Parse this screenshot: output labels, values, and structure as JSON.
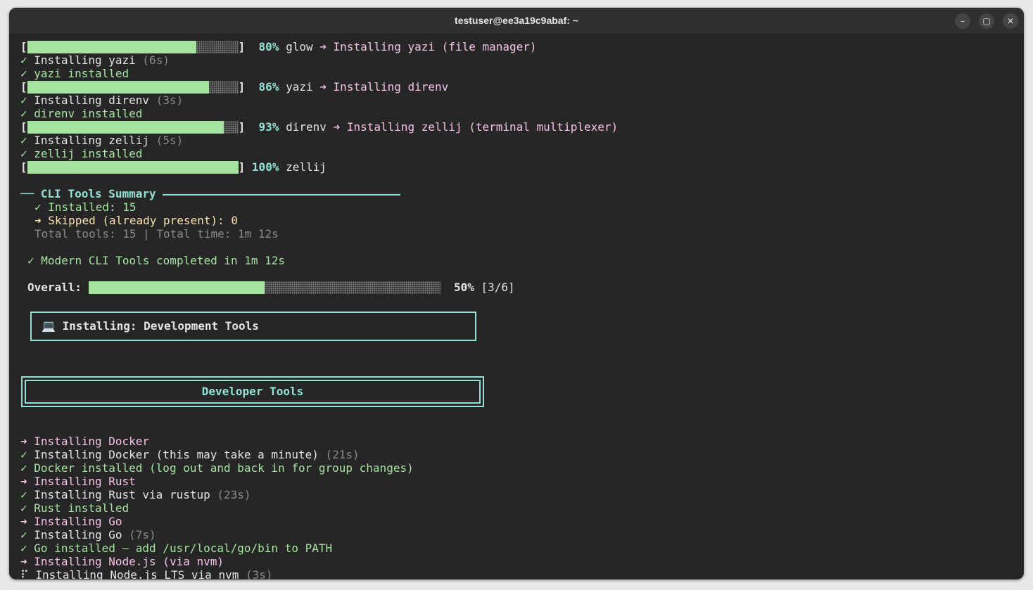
{
  "window": {
    "title": "testuser@ee3a19c9abaf: ~",
    "minimize_icon": "–",
    "maximize_icon": "▢",
    "close_icon": "✕"
  },
  "progress_lines": [
    {
      "open": "[",
      "close": "]",
      "percent_text": "80%",
      "progress": 0.8,
      "prev": "glow",
      "arrow": "➜",
      "message": "Installing yazi (file manager)"
    },
    {
      "open": "[",
      "close": "]",
      "percent_text": "86%",
      "progress": 0.86,
      "prev": "yazi",
      "arrow": "➜",
      "message": "Installing direnv"
    },
    {
      "open": "[",
      "close": "]",
      "percent_text": "93%",
      "progress": 0.93,
      "prev": "direnv",
      "arrow": "➜",
      "message": "Installing zellij (terminal multiplexer)"
    },
    {
      "open": "[",
      "close": "]",
      "percent_text": "100%",
      "progress": 1.0,
      "prev": "zellij"
    }
  ],
  "step_lines": [
    {
      "icon": "✓",
      "text": "Installing yazi",
      "duration": "(6s)"
    },
    {
      "icon": "✓",
      "text": "yazi installed"
    },
    {
      "icon": "✓",
      "text": "Installing direnv",
      "duration": "(3s)"
    },
    {
      "icon": "✓",
      "text": "direnv installed"
    },
    {
      "icon": "✓",
      "text": "Installing zellij",
      "duration": "(5s)"
    },
    {
      "icon": "✓",
      "text": "zellij installed"
    }
  ],
  "summary": {
    "header_prefix": "──",
    "title": "CLI Tools Summary",
    "installed_icon": "✓",
    "installed": "Installed: 15",
    "skipped_icon": "➜",
    "skipped": "Skipped (already present): 0",
    "totals": "Total tools: 15 | Total time: 1m 12s"
  },
  "completed": {
    "icon": "✓",
    "text": "Modern CLI Tools completed in 1m 12s"
  },
  "overall": {
    "label": "Overall:",
    "progress": 0.5,
    "percent_text": "50%",
    "count": "[3/6]"
  },
  "installing_box": {
    "icon": "💻",
    "text": "Installing: Development Tools"
  },
  "section_box": {
    "title": "Developer Tools"
  },
  "dev_lines": [
    {
      "icon": "➜",
      "text": "Installing Docker"
    },
    {
      "icon": "✓",
      "text": "Installing Docker (this may take a minute)",
      "duration": "(21s)"
    },
    {
      "icon": "✓",
      "text": "Docker installed (log out and back in for group changes)"
    },
    {
      "icon": "➜",
      "text": "Installing Rust"
    },
    {
      "icon": "✓",
      "text": "Installing Rust via rustup",
      "duration": "(23s)"
    },
    {
      "icon": "✓",
      "text": "Rust installed"
    },
    {
      "icon": "➜",
      "text": "Installing Go"
    },
    {
      "icon": "✓",
      "text": "Installing Go",
      "duration": "(7s)"
    },
    {
      "icon": "✓",
      "text": "Go installed — add /usr/local/go/bin to PATH"
    },
    {
      "icon": "➜",
      "text": "Installing Node.js (via nvm)"
    },
    {
      "icon": "⠏",
      "text": "Installing Node.js LTS via nvm",
      "duration": "(3s)"
    }
  ]
}
